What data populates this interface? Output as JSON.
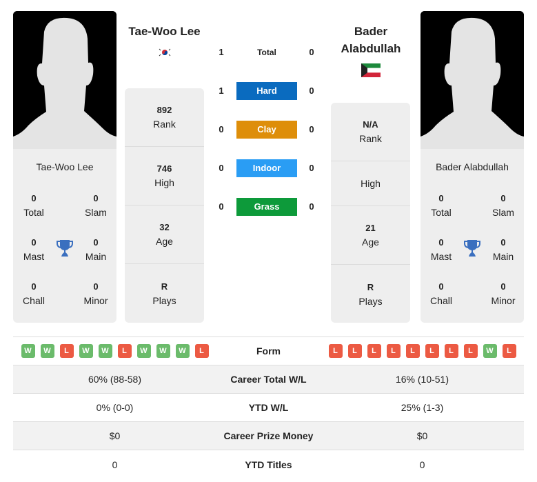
{
  "player1": {
    "name": "Tae-Woo Lee",
    "flag": "south-korea-flag",
    "titles": {
      "total": {
        "value": "0",
        "label": "Total"
      },
      "slam": {
        "value": "0",
        "label": "Slam"
      },
      "mast": {
        "value": "0",
        "label": "Mast"
      },
      "main": {
        "value": "0",
        "label": "Main"
      },
      "chall": {
        "value": "0",
        "label": "Chall"
      },
      "minor": {
        "value": "0",
        "label": "Minor"
      }
    },
    "stats": [
      {
        "value": "892",
        "label": "Rank"
      },
      {
        "value": "746",
        "label": "High"
      },
      {
        "value": "32",
        "label": "Age"
      },
      {
        "value": "R",
        "label": "Plays"
      }
    ],
    "form": [
      "W",
      "W",
      "L",
      "W",
      "W",
      "L",
      "W",
      "W",
      "W",
      "L"
    ]
  },
  "player2": {
    "name_line1": "Bader",
    "name_line2": "Alabdullah",
    "name": "Bader Alabdullah",
    "flag": "kuwait-flag",
    "titles": {
      "total": {
        "value": "0",
        "label": "Total"
      },
      "slam": {
        "value": "0",
        "label": "Slam"
      },
      "mast": {
        "value": "0",
        "label": "Mast"
      },
      "main": {
        "value": "0",
        "label": "Main"
      },
      "chall": {
        "value": "0",
        "label": "Chall"
      },
      "minor": {
        "value": "0",
        "label": "Minor"
      }
    },
    "stats": [
      {
        "value": "N/A",
        "label": "Rank"
      },
      {
        "value": "",
        "label": "High"
      },
      {
        "value": "21",
        "label": "Age"
      },
      {
        "value": "R",
        "label": "Plays"
      }
    ],
    "form": [
      "L",
      "L",
      "L",
      "L",
      "L",
      "L",
      "L",
      "L",
      "W",
      "L"
    ]
  },
  "h2h": [
    {
      "label": "Total",
      "p1": "1",
      "p2": "0",
      "color": ""
    },
    {
      "label": "Hard",
      "p1": "1",
      "p2": "0",
      "color": "#0a6bbf"
    },
    {
      "label": "Clay",
      "p1": "0",
      "p2": "0",
      "color": "#de8e0a"
    },
    {
      "label": "Indoor",
      "p1": "0",
      "p2": "0",
      "color": "#2a9df4"
    },
    {
      "label": "Grass",
      "p1": "0",
      "p2": "0",
      "color": "#0d9a3a"
    }
  ],
  "table": [
    {
      "label": "Form",
      "p1": "",
      "p2": ""
    },
    {
      "label": "Career Total W/L",
      "p1": "60% (88-58)",
      "p2": "16% (10-51)"
    },
    {
      "label": "YTD W/L",
      "p1": "0% (0-0)",
      "p2": "25% (1-3)"
    },
    {
      "label": "Career Prize Money",
      "p1": "$0",
      "p2": "$0"
    },
    {
      "label": "YTD Titles",
      "p1": "0",
      "p2": "0"
    }
  ],
  "colors": {
    "win": "#6bbb6b",
    "loss": "#ec5a43",
    "trophy": "#3a6fbf"
  }
}
